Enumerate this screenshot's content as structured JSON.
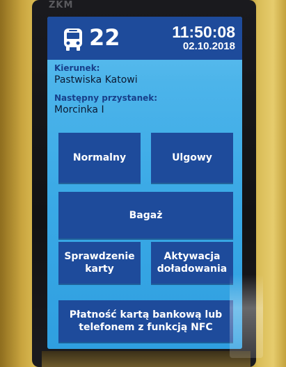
{
  "device": {
    "bezel_logo": "ZKM"
  },
  "header": {
    "icon": "bus-icon",
    "line_number": "22",
    "time": "11:50:08",
    "date": "02.10.2018"
  },
  "info": {
    "direction_label": "Kierunek:",
    "direction_value": "Pastwiska Katowi",
    "next_stop_label": "Następny przystanek:",
    "next_stop_value": "Morcinka I"
  },
  "buttons": {
    "normal": "Normalny",
    "reduced": "Ulgowy",
    "luggage": "Bagaż",
    "check_card_line1": "Sprawdzenie",
    "check_card_line2": "karty",
    "activate_line1": "Aktywacja",
    "activate_line2": "doładowania",
    "nfc_line1": "Płatność kartą bankową lub",
    "nfc_line2": "telefonem z funkcją NFC"
  },
  "colors": {
    "screen_bg": "#3aa9e6",
    "button_bg": "#1e4b9b",
    "label_color": "#173f8a"
  }
}
